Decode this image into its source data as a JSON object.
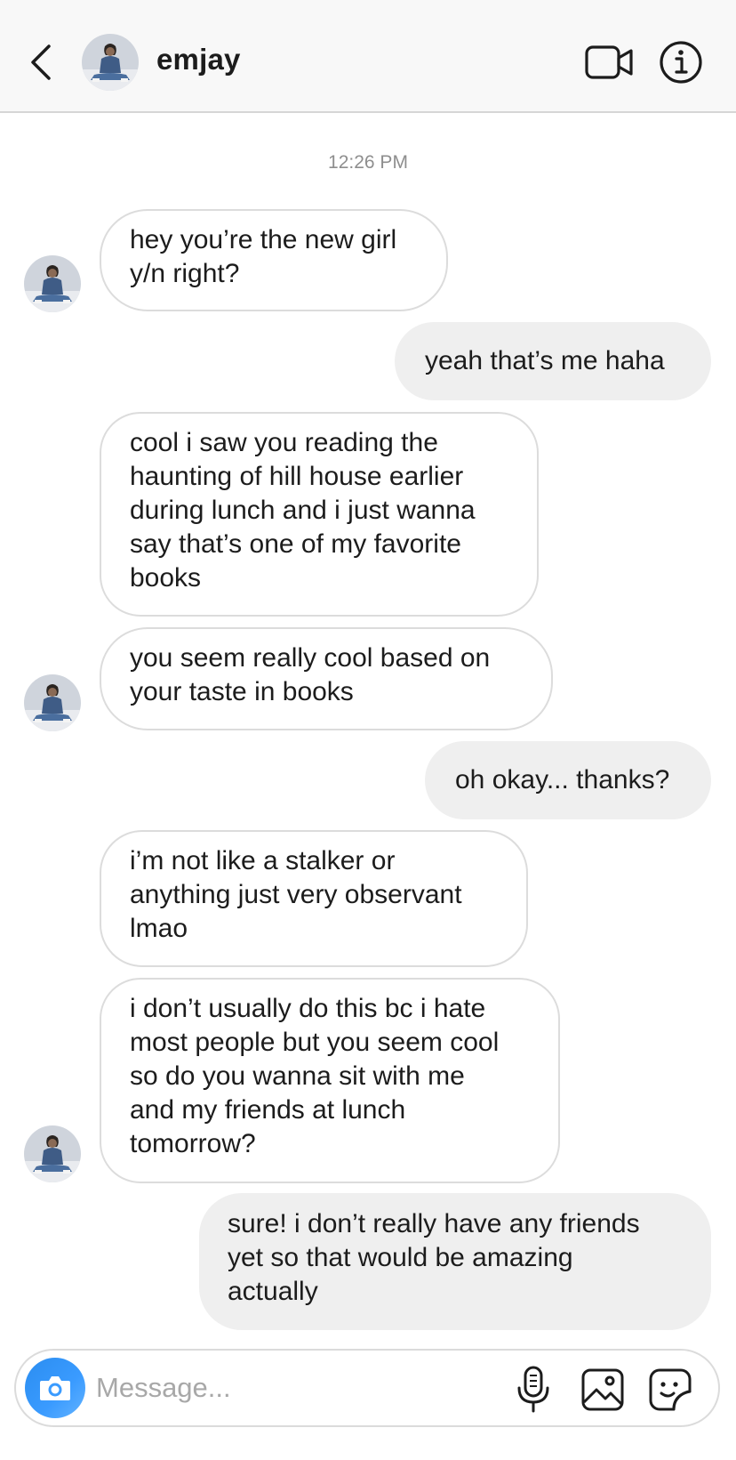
{
  "header": {
    "contact_name": "emjay"
  },
  "icons": {
    "back": "chevron-left-icon",
    "video": "video-camera-icon",
    "info": "info-icon",
    "camera": "camera-icon",
    "mic": "microphone-icon",
    "gallery": "image-icon",
    "sticker": "sticker-icon"
  },
  "conversation": {
    "timestamp": "12:26 PM",
    "messages": [
      {
        "from": "them",
        "lines": [
          "hey you’re the new girl",
          "y/n right?"
        ]
      },
      {
        "from": "me",
        "lines": [
          "yeah that’s me haha"
        ]
      },
      {
        "from": "them",
        "lines": [
          "cool i saw you reading the",
          "haunting of hill house earlier",
          "during lunch and i just wanna",
          "say that’s one of my favorite",
          "books"
        ]
      },
      {
        "from": "them",
        "lines": [
          "you seem really cool based on",
          "your taste in books"
        ]
      },
      {
        "from": "me",
        "lines": [
          "oh okay... thanks?"
        ]
      },
      {
        "from": "them",
        "lines": [
          "i’m not like a stalker or",
          "anything just very observant",
          "lmao"
        ]
      },
      {
        "from": "them",
        "lines": [
          "i don’t usually do this bc i hate",
          "most people but you seem cool",
          "so do you wanna sit with me",
          "and my friends at lunch",
          "tomorrow?"
        ]
      },
      {
        "from": "me",
        "lines": [
          "sure! i don’t really have any friends",
          "yet so that would be amazing",
          "actually"
        ]
      }
    ]
  },
  "composer": {
    "placeholder": "Message...",
    "value": ""
  },
  "colors": {
    "outgoing_bubble": "#efefef",
    "incoming_border": "#dcdcdc",
    "camera_button": "#3a9bff",
    "timestamp_text": "#8e8e8e"
  }
}
